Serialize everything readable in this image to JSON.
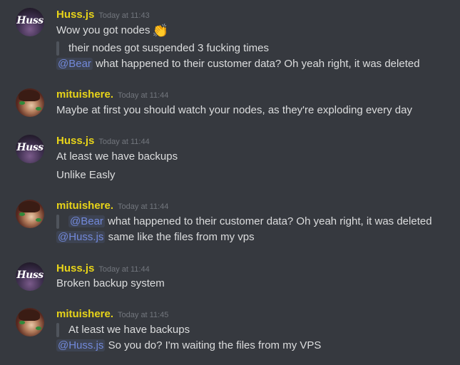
{
  "messages": [
    {
      "author": "Huss.js",
      "timestamp": "Today at 11:43",
      "avatar_label": "Huss",
      "lines": {
        "l1": "Wow you got nodes",
        "l1_emoji": "👏",
        "l2_quote": "their nodes got suspended 3 fucking times",
        "l3_mention": "@Bear",
        "l3_text": "what happened to their customer data? Oh yeah right, it was deleted"
      }
    },
    {
      "author": "mituishere.",
      "timestamp": "Today at 11:44",
      "lines": {
        "l1": "Maybe at first you should watch your nodes, as they're exploding every day"
      }
    },
    {
      "author": "Huss.js",
      "timestamp": "Today at 11:44",
      "avatar_label": "Huss",
      "lines": {
        "l1": "At least we have backups",
        "l2": "Unlike Easly"
      }
    },
    {
      "author": "mituishere.",
      "timestamp": "Today at 11:44",
      "lines": {
        "l1_quote_mention": "@Bear",
        "l1_quote_text": "what happened to their customer data? Oh yeah right, it was deleted",
        "l2_mention": "@Huss.js",
        "l2_text": "same like the files from my vps"
      }
    },
    {
      "author": "Huss.js",
      "timestamp": "Today at 11:44",
      "avatar_label": "Huss",
      "lines": {
        "l1": "Broken backup system"
      }
    },
    {
      "author": "mituishere.",
      "timestamp": "Today at 11:45",
      "lines": {
        "l1_quote": "At least we have backups",
        "l2_mention": "@Huss.js",
        "l2_text": "So you do? I'm waiting the files from my VPS"
      }
    }
  ]
}
